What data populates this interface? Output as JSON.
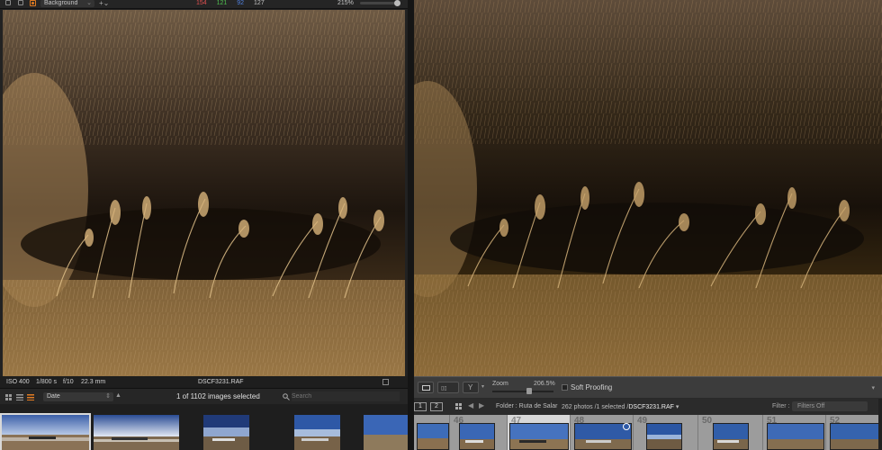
{
  "left_app": {
    "toolbar": {
      "layer_select": "Background",
      "histogram_values": [
        {
          "value": "154",
          "color": "#e05050"
        },
        {
          "value": "121",
          "color": "#50c050"
        },
        {
          "value": "92",
          "color": "#5080e0"
        },
        {
          "value": "127",
          "color": "#c0c0c0"
        }
      ],
      "zoom": "215%"
    },
    "info_bar": {
      "iso": "ISO 400",
      "shutter": "1/800 s",
      "aperture": "f/10",
      "focal": "22.3 mm",
      "filename": "DSCF3231.RAF"
    },
    "browser": {
      "sort_label": "Date",
      "selection_count": "1 of 1102 images selected",
      "search_placeholder": "Search"
    }
  },
  "right_app": {
    "toolbar": {
      "zoom_label": "Zoom",
      "zoom_value": "206.5%",
      "soft_proofing": "Soft Proofing"
    },
    "filmbar": {
      "monitor_1": "1",
      "monitor_2": "2",
      "folder": "Folder : Ruta de Salar",
      "photos_prefix": "262 photos /1 selected /",
      "photos_file": "DSCF3231.RAF",
      "filter_label": "Filter :",
      "filter_value": "Filters Off"
    },
    "filmstrip": [
      "46",
      "47",
      "48",
      "49",
      "50",
      "51",
      "52"
    ]
  },
  "colors": {
    "capture_one_accent": "#e07b22",
    "selected_cell": "#d8d8d8"
  }
}
